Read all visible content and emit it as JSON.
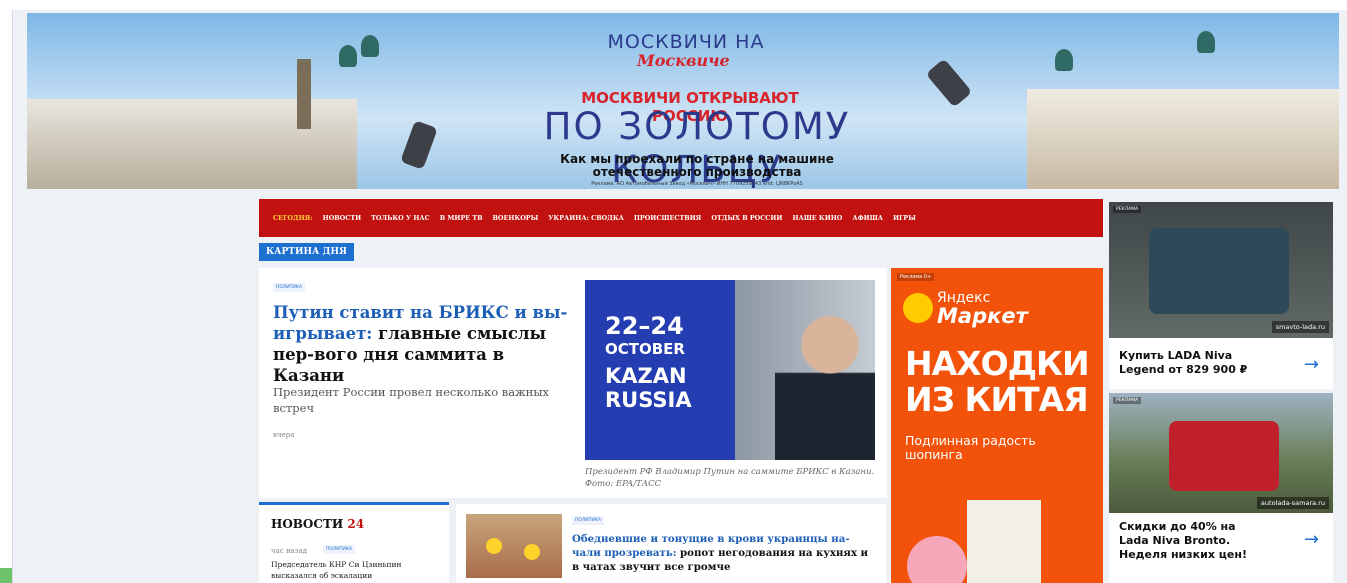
{
  "banner": {
    "logo_top": "МОСКВИЧИ НА",
    "logo_script": "Москвиче",
    "tagline": "МОСКВИЧИ ОТКРЫВАЮТ РОССИЮ",
    "headline": "ПО ЗОЛОТОМУ КОЛЬЦУ",
    "sub_line1": "Как мы проехали по стране на машине",
    "sub_line2": "отечественного производства",
    "fine": "Реклама. АО Автомобильный Завод «Москвич» ИНН 7709259743 erid: LjN8KPoAS"
  },
  "nav": {
    "items": [
      "СЕГОДНЯ:",
      "НОВОСТИ",
      "ТОЛЬКО У НАС",
      "В МИРЕ ТВ",
      "ВОЕНКОРЫ",
      "УКРАИНА: СВОДКА",
      "ПРОИСШЕСТВИЯ",
      "ОТДЫХ В РОССИИ",
      "НАШЕ КИНО",
      "АФИША",
      "ИГРЫ"
    ]
  },
  "section": {
    "title": "КАРТИНА ДНЯ"
  },
  "main_article": {
    "tag": "ПОЛИТИКА",
    "title_highlight": "Путин ставит на БРИКС и вы-игрывает:",
    "title_rest": " главные смыслы пер-вого дня саммита в Казани",
    "lead": "Президент России провел несколько важных встреч",
    "time": "вчера",
    "photo_text": [
      "22–24",
      "OCTOBER",
      "KAZAN",
      "RUSSIA"
    ],
    "caption": "Президент РФ Владимир Путин на саммите БРИКС в Казани. Фото: EPA/ТАСС"
  },
  "ad_market": {
    "label": "Реклама 0+",
    "brand_small": "Яндекс",
    "brand_big": "Маркет",
    "headline": "НАХОДКИ ИЗ КИТАЯ",
    "sub": "Подлинная радость шопинга"
  },
  "news24": {
    "title": "НОВОСТИ",
    "count": "24",
    "time": "час назад",
    "tag": "ПОЛИТИКА",
    "text": "Председатель КНР Си Цзиньпин высказался об эскалации"
  },
  "article2": {
    "tag": "ПОЛИТИКА",
    "title_highlight": "Обедневшие и тонущие в крови украинцы на-чали прозревать:",
    "title_rest": " ропот негодования на кухнях и в чатах звучит все громче"
  },
  "sidebar_ads": [
    {
      "label": "РЕКЛАМА",
      "domain": "smavto-lada.ru",
      "caption": "Купить LADA Niva Legend от 829 900 ₽"
    },
    {
      "label": "РЕКЛАМА",
      "domain": "autolada-samara.ru",
      "caption": "Скидки до 40% на Lada Niva Bronto. Неделя низких цен!"
    }
  ],
  "colors": {
    "nav_red": "#c1120f",
    "accent_blue": "#1d6fd0",
    "market_orange": "#f3520b",
    "today_yellow": "#ffd23b"
  }
}
